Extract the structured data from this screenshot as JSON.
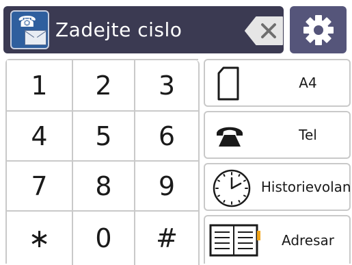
{
  "header": {
    "title": "Zadejte cislo",
    "icons": {
      "fax": "fax-envelope-icon",
      "backspace": "backspace-icon",
      "settings": "gear-icon"
    },
    "colors": {
      "bar": "#3b3a52",
      "settings_bg": "#55557a",
      "fax_bg": "#2f5f9e"
    }
  },
  "keypad": {
    "keys": [
      "1",
      "2",
      "3",
      "4",
      "5",
      "6",
      "7",
      "8",
      "9",
      "∗",
      "0",
      "#"
    ]
  },
  "side_buttons": {
    "paper": {
      "label": "A4",
      "icon": "paper-icon"
    },
    "tel": {
      "label": "Tel",
      "icon": "phone-icon"
    },
    "history": {
      "label_line1": "Historie",
      "label_line2": "volani",
      "icon": "clock-icon"
    },
    "address": {
      "label": "Adresar",
      "icon": "address-book-icon"
    }
  }
}
